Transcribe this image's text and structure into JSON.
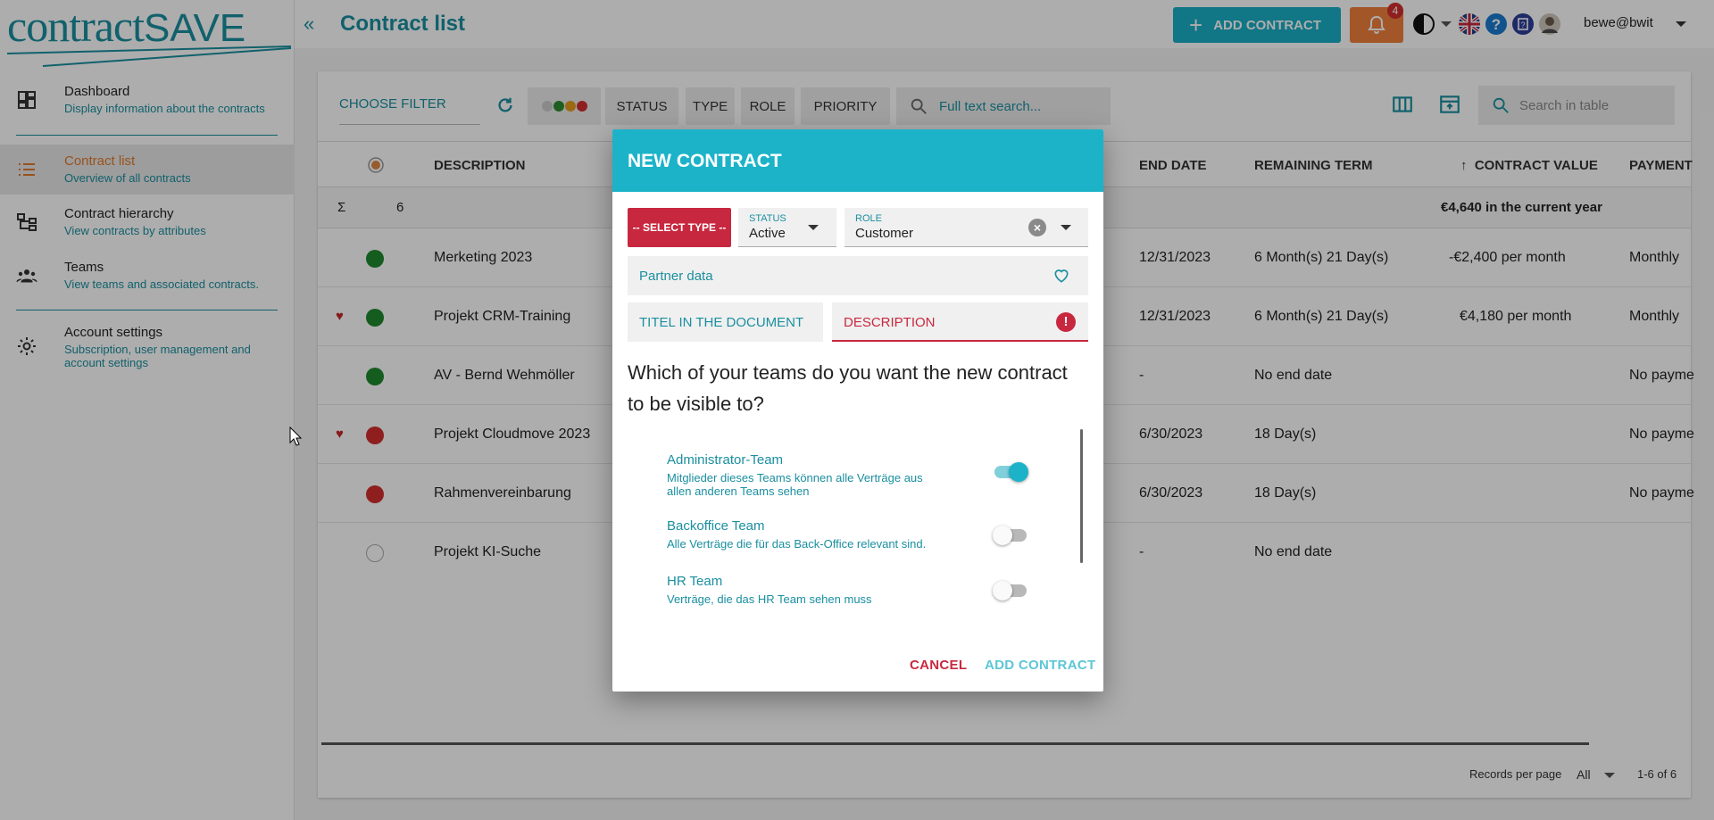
{
  "colors": {
    "accent": "#1a8fa0",
    "header": "#1cb3c9",
    "orange": "#e07a2c",
    "error": "#c8283f",
    "green": "#1e8a2e",
    "red": "#d32f2f"
  },
  "logo": {
    "text_main": "contract",
    "text_save": "SAVE"
  },
  "sidebar": {
    "items": [
      {
        "title": "Dashboard",
        "sub": "Display information about the contracts",
        "icon": "dashboard-icon"
      },
      {
        "title": "Contract list",
        "sub": "Overview of all contracts",
        "icon": "list-icon"
      },
      {
        "title": "Contract hierarchy",
        "sub": "View contracts by attributes",
        "icon": "hierarchy-icon"
      },
      {
        "title": "Teams",
        "sub": "View teams and associated contracts.",
        "icon": "teams-icon"
      },
      {
        "title": "Account settings",
        "sub_line1": "Subscription, user management and",
        "sub_line2": "account settings",
        "icon": "gear-icon"
      }
    ]
  },
  "topbar": {
    "title": "Contract list",
    "add_contract": "ADD CONTRACT",
    "notifications": "4",
    "user": "bewe@bwit"
  },
  "filters": {
    "choose": "CHOOSE FILTER",
    "chips": [
      "STATUS",
      "TYPE",
      "ROLE",
      "PRIORITY"
    ],
    "fulltext_placeholder": "Full text search...",
    "table_search_placeholder": "Search in table"
  },
  "table": {
    "headers": {
      "description": "DESCRIPTION",
      "end_date": "END DATE",
      "remaining": "REMAINING TERM",
      "value": "CONTRACT VALUE",
      "payment": "PAYMENT"
    },
    "sum": {
      "symbol": "Σ",
      "count": "6",
      "value": "€4,640 in the current year"
    },
    "rows": [
      {
        "desc": "Merketing 2023",
        "end": "12/31/2023",
        "remaining": "6 Month(s) 21 Day(s)",
        "value": "-€2,400 per month",
        "payment": "Monthly",
        "status": "green",
        "fav": false
      },
      {
        "desc": "Projekt CRM-Training",
        "end": "12/31/2023",
        "remaining": "6 Month(s) 21 Day(s)",
        "value": "€4,180 per month",
        "payment": "Monthly",
        "status": "green",
        "fav": true
      },
      {
        "desc": "AV - Bernd Wehmöller",
        "end": "-",
        "remaining": "No end date",
        "value": "",
        "payment": "No payme",
        "status": "green",
        "fav": false
      },
      {
        "desc": "Projekt Cloudmove 2023",
        "end": "6/30/2023",
        "remaining": "18 Day(s)",
        "value": "",
        "payment": "No payme",
        "status": "red",
        "fav": true
      },
      {
        "desc": "Rahmenvereinbarung",
        "end": "6/30/2023",
        "remaining": "18 Day(s)",
        "value": "",
        "payment": "No payme",
        "status": "red",
        "fav": false
      },
      {
        "desc": "Projekt KI-Suche",
        "end": "-",
        "remaining": "No end date",
        "value": "",
        "payment": "",
        "status": "none",
        "fav": false
      }
    ],
    "pager": {
      "label": "Records per page",
      "per_page": "All",
      "range": "1-6 of 6"
    }
  },
  "dialog": {
    "title": "NEW CONTRACT",
    "select_type": "-- SELECT TYPE --",
    "status": {
      "label": "STATUS",
      "value": "Active"
    },
    "role": {
      "label": "ROLE",
      "value": "Customer"
    },
    "partner_placeholder": "Partner data",
    "titel_placeholder": "TITEL IN THE DOCUMENT",
    "description_placeholder": "DESCRIPTION",
    "question": "Which of your teams do you want the new contract to be visible to?",
    "teams": [
      {
        "name": "Administrator-Team",
        "desc_line1": "Mitglieder dieses Teams können alle Verträge aus",
        "desc_line2": "allen anderen Teams sehen",
        "enabled": true
      },
      {
        "name": "Backoffice Team",
        "desc_line1": "Alle Verträge die für das Back-Office relevant sind.",
        "desc_line2": "",
        "enabled": false
      },
      {
        "name": "HR Team",
        "desc_line1": "Verträge, die das HR Team sehen muss",
        "desc_line2": "",
        "enabled": false
      }
    ],
    "cancel": "CANCEL",
    "add": "ADD CONTRACT"
  }
}
